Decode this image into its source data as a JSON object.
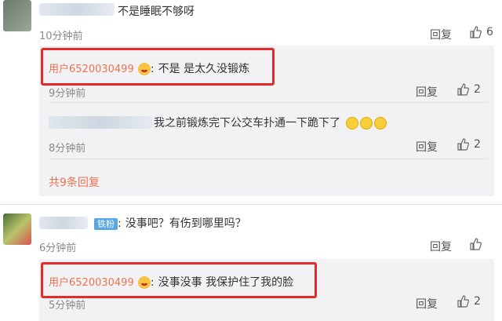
{
  "colors": {
    "accent": "#eb7350",
    "highlight_box": "#e52a2a",
    "panel": "#f2f2f5"
  },
  "comment1": {
    "text": "不是睡眠不够呀",
    "time": "10分钟前",
    "reply": "回复",
    "likes": "6",
    "replies": [
      {
        "user": "用户6520030499",
        "sep": ":",
        "text": "不是 是太久没锻炼",
        "time": "9分钟前",
        "reply": "回复",
        "likes": "2"
      },
      {
        "user": "",
        "text": "我之前锻炼完下公交车扑通一下跪下了",
        "time": "8分钟前",
        "reply": "回复",
        "likes": "2"
      }
    ],
    "more": "共9条回复"
  },
  "comment2": {
    "badge": "铁粉",
    "sep": ":",
    "text": "没事吧？有伤到哪里吗？",
    "time": "6分钟前",
    "reply": "回复",
    "likes": "",
    "replies": [
      {
        "user": "用户6520030499",
        "sep": ":",
        "text": "没事没事 我保护住了我的脸",
        "time": "5分钟前",
        "reply": "回复",
        "likes": "2"
      }
    ]
  },
  "icons": {
    "like": "thumbs-up-icon",
    "emoji": "smile-emoji-icon",
    "cry": "crying-emoji-icon"
  }
}
